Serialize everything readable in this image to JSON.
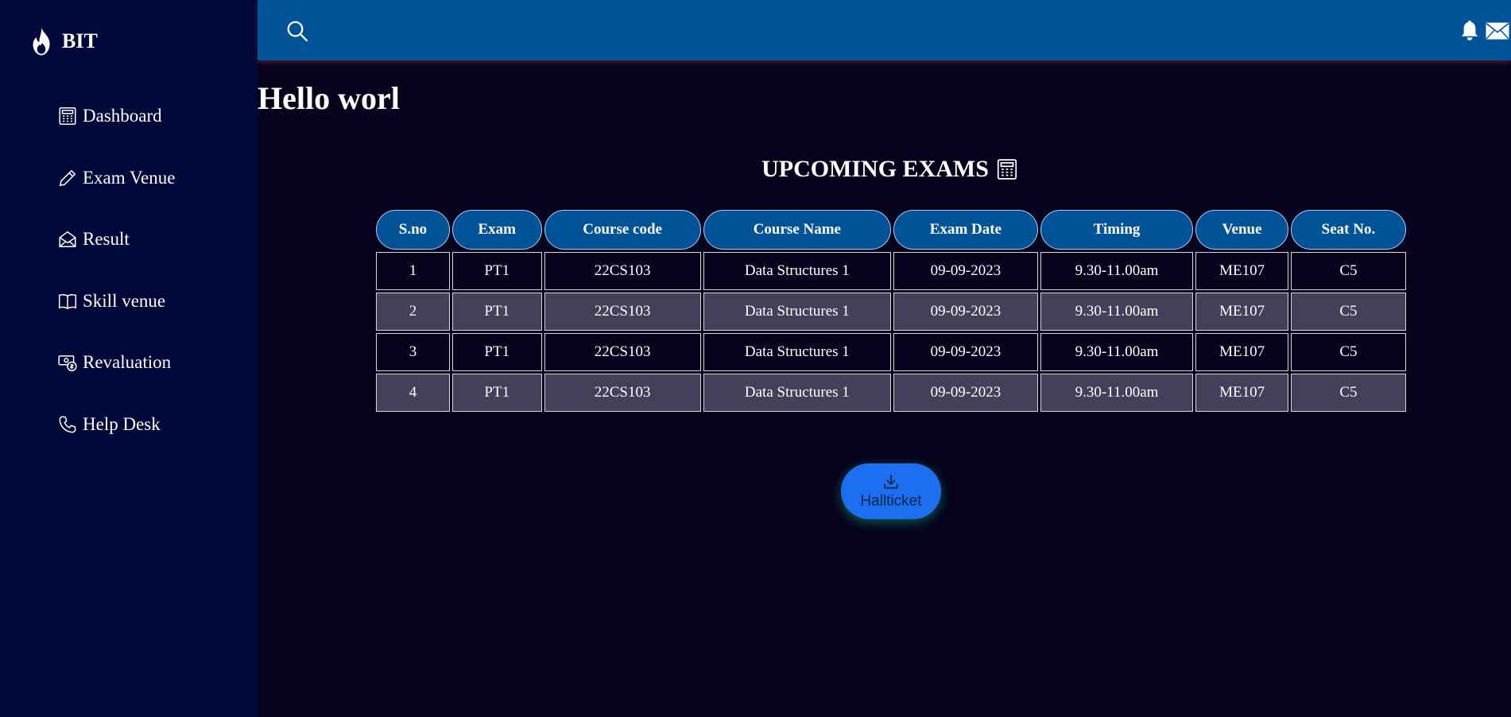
{
  "brand": {
    "name": "BIT"
  },
  "sidebar": {
    "items": [
      {
        "label": "Dashboard",
        "icon": "calculator-icon"
      },
      {
        "label": "Exam Venue",
        "icon": "pencil-icon"
      },
      {
        "label": "Result",
        "icon": "envelope-open-icon"
      },
      {
        "label": "Skill venue",
        "icon": "book-icon"
      },
      {
        "label": "Revaluation",
        "icon": "cash-coin-icon"
      },
      {
        "label": "Help Desk",
        "icon": "phone-icon"
      }
    ]
  },
  "topbar": {
    "icons": [
      "search-icon",
      "bell-icon",
      "envelope-icon"
    ]
  },
  "main": {
    "greeting": "Hello worl",
    "section_title": "UPCOMING EXAMS",
    "table": {
      "headers": [
        "S.no",
        "Exam",
        "Course code",
        "Course Name",
        "Exam Date",
        "Timing",
        "Venue",
        "Seat No."
      ],
      "rows": [
        [
          "1",
          "PT1",
          "22CS103",
          "Data Structures 1",
          "09-09-2023",
          "9.30-11.00am",
          "ME107",
          "C5"
        ],
        [
          "2",
          "PT1",
          "22CS103",
          "Data Structures 1",
          "09-09-2023",
          "9.30-11.00am",
          "ME107",
          "C5"
        ],
        [
          "3",
          "PT1",
          "22CS103",
          "Data Structures 1",
          "09-09-2023",
          "9.30-11.00am",
          "ME107",
          "C5"
        ],
        [
          "4",
          "PT1",
          "22CS103",
          "Data Structures 1",
          "09-09-2023",
          "9.30-11.00am",
          "ME107",
          "C5"
        ]
      ]
    },
    "hallticket_button": {
      "label": "Hallticket",
      "icon": "download-icon"
    }
  },
  "colors": {
    "background": "#07031d",
    "sidebar": "#000839",
    "topbar": "#005397",
    "header_cell": "#005397",
    "alt_row": "#463f5a",
    "button": "#1d6ff2"
  }
}
